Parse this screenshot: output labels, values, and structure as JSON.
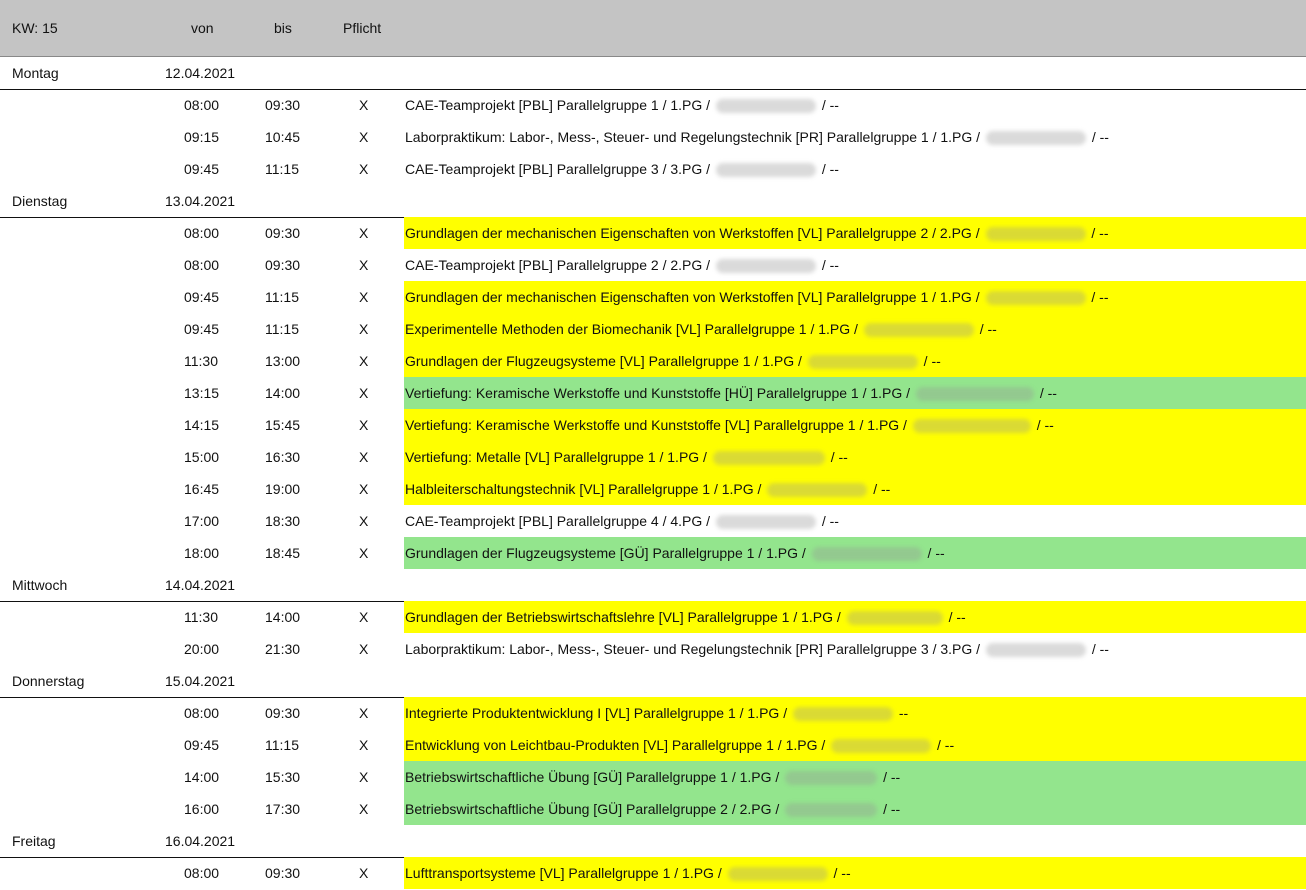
{
  "header": {
    "week": "KW: 15",
    "from": "von",
    "to": "bis",
    "mandatory": "Pflicht"
  },
  "days": [
    {
      "name": "Montag",
      "date": "12.04.2021",
      "events": [
        {
          "from": "08:00",
          "to": "09:30",
          "mandatory": "X",
          "course": "CAE-Teamprojekt [PBL] Parallelgruppe 1 / 1.PG /",
          "suffix": "/ --",
          "color": "white"
        },
        {
          "from": "09:15",
          "to": "10:45",
          "mandatory": "X",
          "course": "Laborpraktikum: Labor-, Mess-, Steuer- und Regelungstechnik [PR] Parallelgruppe 1 / 1.PG /",
          "suffix": "/ --",
          "color": "white"
        },
        {
          "from": "09:45",
          "to": "11:15",
          "mandatory": "X",
          "course": "CAE-Teamprojekt [PBL] Parallelgruppe 3 / 3.PG /",
          "suffix": "/ --",
          "color": "white"
        }
      ]
    },
    {
      "name": "Dienstag",
      "date": "13.04.2021",
      "events": [
        {
          "from": "08:00",
          "to": "09:30",
          "mandatory": "X",
          "course": "Grundlagen der mechanischen Eigenschaften von Werkstoffen [VL] Parallelgruppe 2 / 2.PG /",
          "suffix": "/ --",
          "color": "yellow"
        },
        {
          "from": "08:00",
          "to": "09:30",
          "mandatory": "X",
          "course": "CAE-Teamprojekt [PBL] Parallelgruppe 2 / 2.PG /",
          "suffix": "/ --",
          "color": "white"
        },
        {
          "from": "09:45",
          "to": "11:15",
          "mandatory": "X",
          "course": "Grundlagen der mechanischen Eigenschaften von Werkstoffen [VL] Parallelgruppe 1 / 1.PG /",
          "suffix": "/ --",
          "color": "yellow"
        },
        {
          "from": "09:45",
          "to": "11:15",
          "mandatory": "X",
          "course": "Experimentelle Methoden der Biomechanik [VL] Parallelgruppe 1 / 1.PG /",
          "suffix": "/ --",
          "color": "yellow"
        },
        {
          "from": "11:30",
          "to": "13:00",
          "mandatory": "X",
          "course": "Grundlagen der Flugzeugsysteme [VL] Parallelgruppe 1 / 1.PG /",
          "suffix": "/ --",
          "color": "yellow"
        },
        {
          "from": "13:15",
          "to": "14:00",
          "mandatory": "X",
          "course": "Vertiefung: Keramische Werkstoffe und Kunststoffe [HÜ] Parallelgruppe 1 / 1.PG /",
          "suffix": "/ --",
          "color": "green"
        },
        {
          "from": "14:15",
          "to": "15:45",
          "mandatory": "X",
          "course": "Vertiefung: Keramische Werkstoffe und Kunststoffe [VL] Parallelgruppe 1 / 1.PG /",
          "suffix": "/ --",
          "color": "yellow"
        },
        {
          "from": "15:00",
          "to": "16:30",
          "mandatory": "X",
          "course": "Vertiefung: Metalle [VL] Parallelgruppe 1 / 1.PG /",
          "suffix": "/ --",
          "color": "yellow"
        },
        {
          "from": "16:45",
          "to": "19:00",
          "mandatory": "X",
          "course": "Halbleiterschaltungstechnik [VL] Parallelgruppe 1 / 1.PG /",
          "suffix": "/ --",
          "color": "yellow"
        },
        {
          "from": "17:00",
          "to": "18:30",
          "mandatory": "X",
          "course": "CAE-Teamprojekt [PBL] Parallelgruppe 4 / 4.PG /",
          "suffix": "/ --",
          "color": "white"
        },
        {
          "from": "18:00",
          "to": "18:45",
          "mandatory": "X",
          "course": "Grundlagen der Flugzeugsysteme [GÜ] Parallelgruppe 1 / 1.PG /",
          "suffix": "/ --",
          "color": "green"
        }
      ]
    },
    {
      "name": "Mittwoch",
      "date": "14.04.2021",
      "events": [
        {
          "from": "11:30",
          "to": "14:00",
          "mandatory": "X",
          "course": "Grundlagen der Betriebswirtschaftslehre [VL] Parallelgruppe 1 / 1.PG /",
          "suffix": "/ --",
          "color": "yellow"
        },
        {
          "from": "20:00",
          "to": "21:30",
          "mandatory": "X",
          "course": "Laborpraktikum: Labor-, Mess-, Steuer- und Regelungstechnik [PR] Parallelgruppe 3 / 3.PG /",
          "suffix": "/ --",
          "color": "white"
        }
      ]
    },
    {
      "name": "Donnerstag",
      "date": "15.04.2021",
      "events": [
        {
          "from": "08:00",
          "to": "09:30",
          "mandatory": "X",
          "course": "Integrierte Produktentwicklung I [VL] Parallelgruppe 1 / 1.PG /",
          "suffix": "--",
          "color": "yellow"
        },
        {
          "from": "09:45",
          "to": "11:15",
          "mandatory": "X",
          "course": "Entwicklung von Leichtbau-Produkten [VL] Parallelgruppe 1 / 1.PG /",
          "suffix": "/ --",
          "color": "yellow"
        },
        {
          "from": "14:00",
          "to": "15:30",
          "mandatory": "X",
          "course": "Betriebswirtschaftliche Übung [GÜ] Parallelgruppe 1 / 1.PG /",
          "suffix": "/ --",
          "color": "green"
        },
        {
          "from": "16:00",
          "to": "17:30",
          "mandatory": "X",
          "course": "Betriebswirtschaftliche Übung [GÜ] Parallelgruppe 2 / 2.PG /",
          "suffix": "/ --",
          "color": "green"
        }
      ]
    },
    {
      "name": "Freitag",
      "date": "16.04.2021",
      "events": [
        {
          "from": "08:00",
          "to": "09:30",
          "mandatory": "X",
          "course": "Lufttransportsysteme [VL] Parallelgruppe 1 / 1.PG /",
          "suffix": "/ --",
          "color": "yellow"
        }
      ]
    }
  ]
}
